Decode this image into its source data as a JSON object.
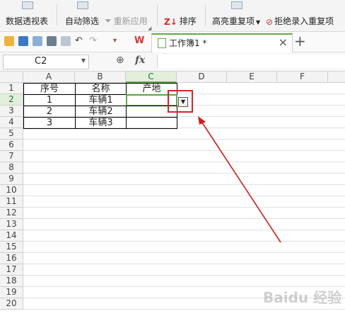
{
  "ribbon": {
    "pivot_label": "数据透视表",
    "autofilter_label": "自动筛选",
    "reapply_label": "重新应用",
    "sort_label": "排序",
    "highlight_dup_label": "高亮重复项",
    "reject_dup_label": "拒绝录入重复项"
  },
  "toolbar": {
    "tab_title": "工作簿1 *",
    "close_glyph": "×",
    "add_glyph": "+"
  },
  "formula_bar": {
    "cell_ref": "C2",
    "fx_label": "fx"
  },
  "sheet": {
    "columns": [
      "A",
      "B",
      "C",
      "D",
      "E",
      "F"
    ],
    "rows": [
      "1",
      "2",
      "3",
      "4",
      "5",
      "6",
      "7",
      "8",
      "9",
      "10",
      "11",
      "12",
      "13",
      "14",
      "15",
      "16",
      "17",
      "18",
      "19",
      "20"
    ],
    "cells": {
      "A1": "序号",
      "B1": "名称",
      "C1": "产地",
      "A2": "1",
      "B2": "车辆1",
      "A3": "2",
      "B3": "车辆2",
      "A4": "3",
      "B4": "车辆3"
    },
    "active_cell": "C2"
  },
  "colors": {
    "accent": "#62a84b",
    "highlight_box": "#e02020",
    "arrow": "#d21a1a"
  }
}
